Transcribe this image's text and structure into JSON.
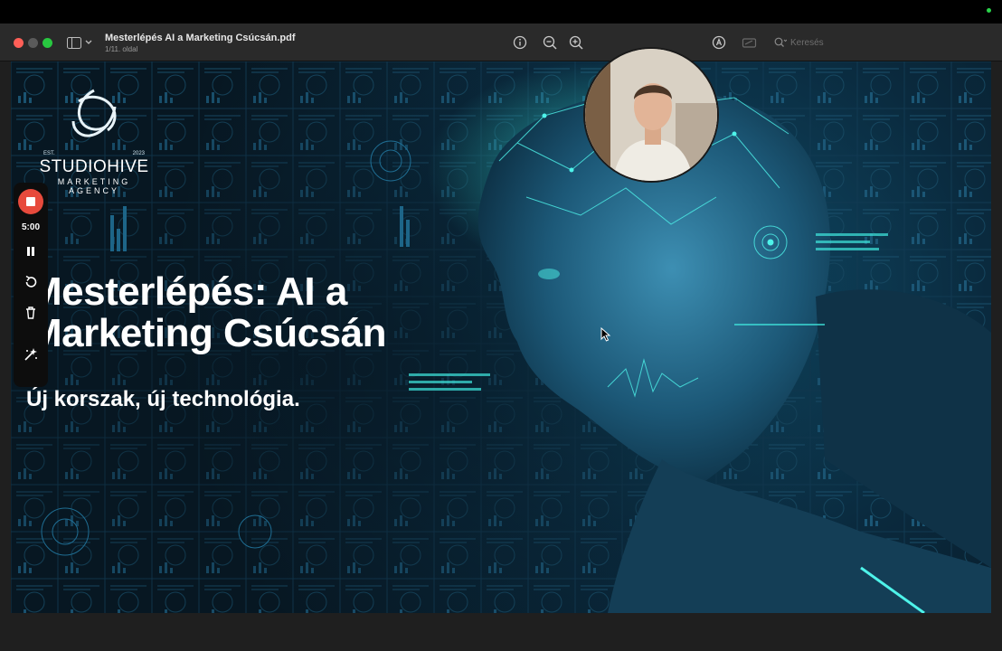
{
  "window": {
    "title": "Mesterlépés AI a Marketing Csúcsán.pdf",
    "page_indicator": "1/11. oldal"
  },
  "toolbar": {
    "icons": [
      "info-icon",
      "zoom-out-icon",
      "zoom-in-icon",
      "share-icon",
      "highlight-icon",
      "markup-icon",
      "annotate-icon"
    ],
    "search_placeholder": "Keresés"
  },
  "slide": {
    "logo": {
      "est_label": "EST.",
      "est_year": "2023",
      "name": "STUDIOHIVE",
      "line1": "MARKETING",
      "line2": "AGENCY"
    },
    "headline_line1": "Mesterlépés: AI a",
    "headline_line2": "Marketing Csúcsán",
    "subheadline": "Új korszak, új technológia."
  },
  "recorder": {
    "time": "5:00",
    "icons": [
      "stop-icon",
      "pause-icon",
      "restart-icon",
      "trash-icon",
      "effects-icon"
    ],
    "accent": "#e74a3c"
  },
  "colors": {
    "slide_bg": "#0a2a3e",
    "accent_cyan": "#28e0d8",
    "titlebar": "#2a2a2a"
  }
}
